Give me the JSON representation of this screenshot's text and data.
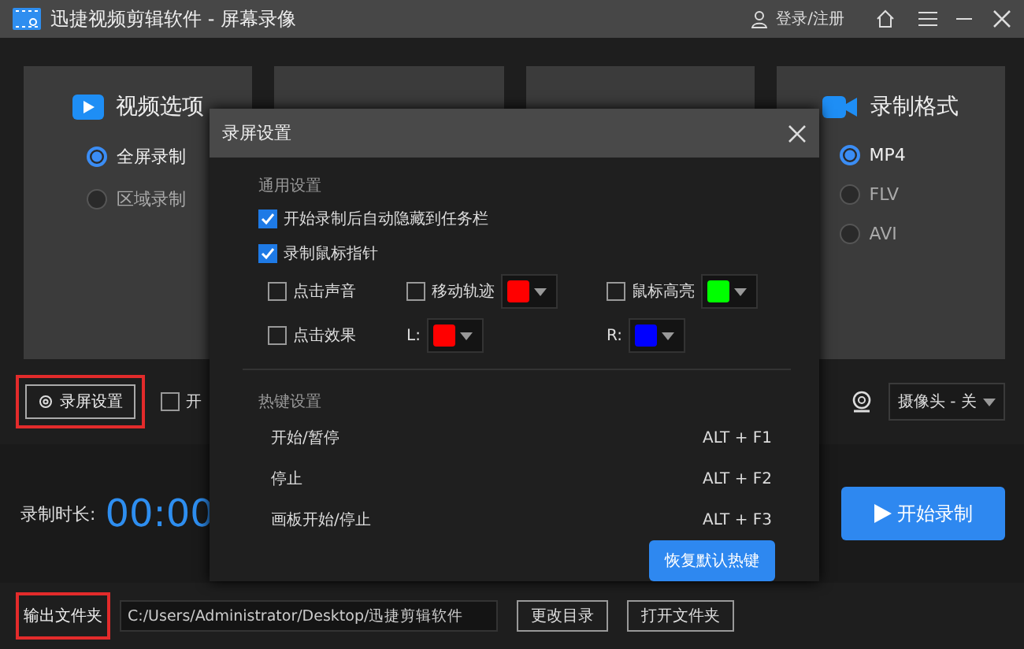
{
  "window": {
    "title": "迅捷视频剪辑软件 - 屏幕录像",
    "account": "登录/注册"
  },
  "panels": [
    {
      "title": "视频选项",
      "options": [
        {
          "label": "全屏录制",
          "selected": true
        },
        {
          "label": "区域录制",
          "selected": false
        }
      ]
    },
    {
      "title": "录制格式",
      "options": [
        {
          "label": "MP4",
          "selected": true
        },
        {
          "label": "FLV",
          "selected": false
        },
        {
          "label": "AVI",
          "selected": false
        }
      ]
    }
  ],
  "toolbar": {
    "settings_button": "录屏设置",
    "option": {
      "label": "开",
      "checked": false
    },
    "camera": "摄像头 - 关"
  },
  "recording": {
    "duration_label": "录制时长:",
    "duration": "00:00",
    "start_button": "开始录制"
  },
  "output": {
    "label": "输出文件夹",
    "path": "C:/Users/Administrator/Desktop/迅捷剪辑软件",
    "buttons": [
      "更改目录",
      "打开文件夹"
    ]
  },
  "dialog": {
    "title": "录屏设置",
    "general": {
      "heading": "通用设置",
      "options": [
        {
          "label": "开始录制后自动隐藏到任务栏",
          "checked": true
        },
        {
          "label": "录制鼠标指针",
          "checked": true
        }
      ],
      "mouse_grid": [
        {
          "kind": "checkbox",
          "label": "点击声音",
          "checked": false
        },
        {
          "kind": "checkbox_color",
          "label": "移动轨迹",
          "checked": false,
          "color": "#ff0000"
        },
        {
          "kind": "checkbox_color",
          "label": "鼠标高亮",
          "checked": false,
          "color": "#00ff00"
        },
        {
          "kind": "checkbox",
          "label": "点击效果",
          "checked": false
        },
        {
          "kind": "color",
          "label": "L:",
          "color": "#ff0000"
        },
        {
          "kind": "color",
          "label": "R:",
          "color": "#0000ff"
        }
      ]
    },
    "hotkeys": {
      "heading": "热键设置",
      "rows": [
        {
          "action": "开始/暂停",
          "keys": "ALT + F1"
        },
        {
          "action": "停止",
          "keys": "ALT + F2"
        },
        {
          "action": "画板开始/停止",
          "keys": "ALT + F3"
        }
      ],
      "reset_button": "恢复默认热键"
    }
  }
}
